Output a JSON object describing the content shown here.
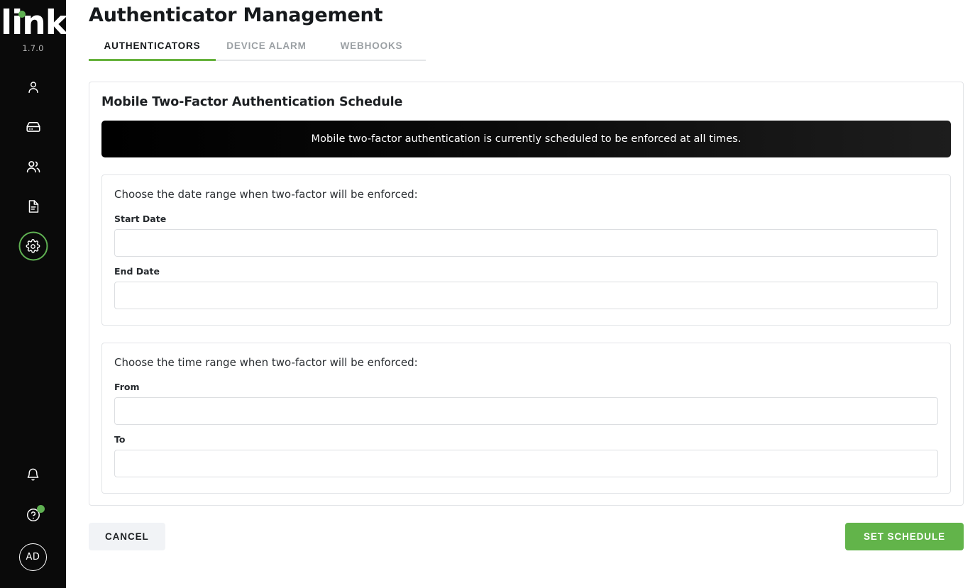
{
  "sidebar": {
    "brand": {
      "logo_text": "link",
      "version": "1.7.0"
    },
    "items": [
      {
        "label": "Profile",
        "icon": "person-icon",
        "active": false
      },
      {
        "label": "Devices",
        "icon": "server-icon",
        "active": false
      },
      {
        "label": "Users",
        "icon": "people-icon",
        "active": false
      },
      {
        "label": "Reports",
        "icon": "document-icon",
        "active": false
      },
      {
        "label": "Settings",
        "icon": "gear-icon",
        "active": true
      }
    ],
    "bottom": {
      "notifications": "Notifications",
      "help": "Help",
      "avatar_initials": "AD"
    }
  },
  "header": {
    "title": "Authenticator Management"
  },
  "tabs": [
    {
      "label": "AUTHENTICATORS",
      "active": true
    },
    {
      "label": "DEVICE ALARM",
      "active": false
    },
    {
      "label": "WEBHOOKS",
      "active": false
    }
  ],
  "card": {
    "title": "Mobile Two-Factor Authentication Schedule",
    "banner": "Mobile two-factor authentication is currently scheduled to be enforced at all times."
  },
  "date_section": {
    "legend": "Choose the date range when two-factor will be enforced:",
    "fields": [
      {
        "label": "Start Date",
        "value": "",
        "placeholder": ""
      },
      {
        "label": "End Date",
        "value": "",
        "placeholder": ""
      }
    ]
  },
  "time_section": {
    "legend": "Choose the time range when two-factor will be enforced:",
    "fields": [
      {
        "label": "From",
        "value": "",
        "placeholder": ""
      },
      {
        "label": "To",
        "value": "",
        "placeholder": ""
      }
    ]
  },
  "footer": {
    "cancel_label": "CANCEL",
    "submit_label": "SET SCHEDULE"
  },
  "colors": {
    "accent_green": "#62b44a",
    "tab_underline": "#66b23c",
    "sidebar_bg": "#0a0a0a",
    "banner_bg": "#000000",
    "cancel_bg": "#f1f3f6"
  }
}
